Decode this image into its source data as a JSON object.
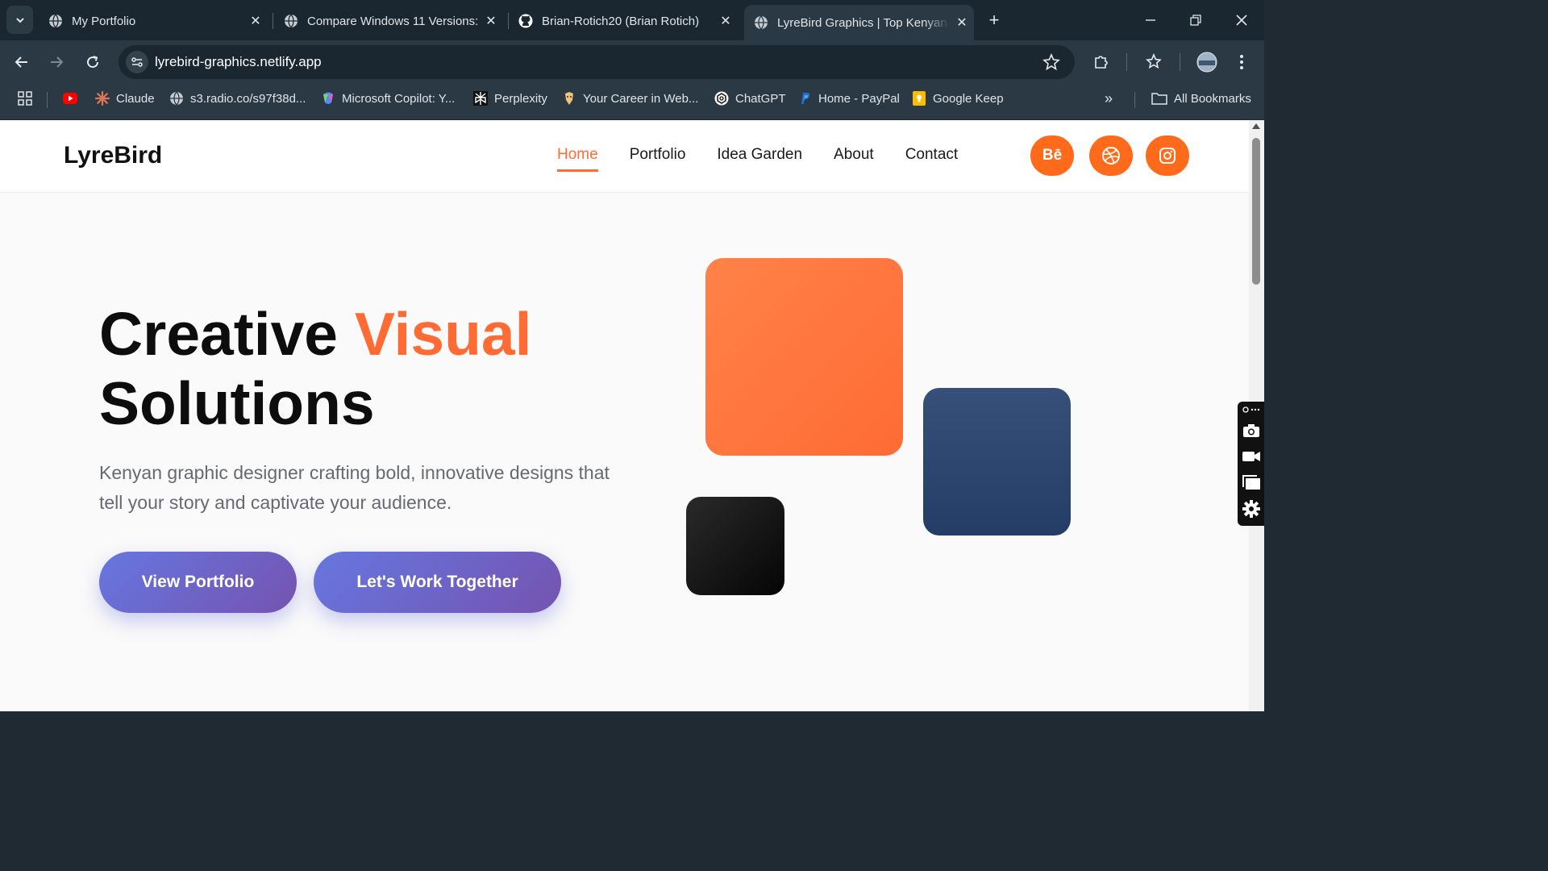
{
  "browser": {
    "tabs": [
      {
        "title": "My Portfolio",
        "active": false
      },
      {
        "title": "Compare Windows 11 Versions:",
        "active": false
      },
      {
        "title": "Brian-Rotich20 (Brian Rotich)",
        "active": false
      },
      {
        "title": "LyreBird Graphics | Top Kenyan Graphic",
        "active": true
      }
    ],
    "url": "lyrebird-graphics.netlify.app",
    "bookmarks": [
      {
        "label": "",
        "icon": "youtube-icon"
      },
      {
        "label": "Claude",
        "icon": "claude-icon"
      },
      {
        "label": "s3.radio.co/s97f38d...",
        "icon": "globe-icon"
      },
      {
        "label": "Microsoft Copilot: Y...",
        "icon": "copilot-icon"
      },
      {
        "label": "Perplexity",
        "icon": "perplexity-icon"
      },
      {
        "label": "Your Career in Web...",
        "icon": "career-icon"
      },
      {
        "label": "ChatGPT",
        "icon": "chatgpt-icon"
      },
      {
        "label": "Home - PayPal",
        "icon": "paypal-icon"
      },
      {
        "label": "Google Keep",
        "icon": "keep-icon"
      }
    ],
    "all_bookmarks": "All Bookmarks",
    "overflow": "»"
  },
  "site": {
    "logo": "LyreBird",
    "nav": [
      {
        "label": "Home",
        "active": true
      },
      {
        "label": "Portfolio",
        "active": false
      },
      {
        "label": "Idea Garden",
        "active": false
      },
      {
        "label": "About",
        "active": false
      },
      {
        "label": "Contact",
        "active": false
      }
    ],
    "social": [
      {
        "name": "behance-icon",
        "glyph": "Bē"
      },
      {
        "name": "dribbble-icon",
        "glyph": ""
      },
      {
        "name": "instagram-icon",
        "glyph": ""
      }
    ],
    "hero": {
      "title_part1": "Creative ",
      "title_accent": "Visual",
      "title_part2": "Solutions",
      "subtitle": "Kenyan graphic designer crafting bold, innovative designs that tell your story and captivate your audience.",
      "cta_primary": "View Portfolio",
      "cta_secondary": "Let's Work Together"
    }
  },
  "colors": {
    "accent": "#ff6b35",
    "button_gradient_start": "#6677e0",
    "button_gradient_end": "#7553b0",
    "navy": "#2a4470",
    "chrome_dark": "#1b2730",
    "chrome": "#2b3944"
  }
}
